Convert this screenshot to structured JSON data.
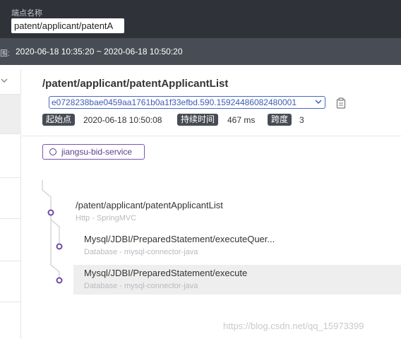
{
  "header": {
    "endpoint_label": "端点名称",
    "endpoint_value": "patent/applicant/patentA",
    "time_label": "围:",
    "time_range": "2020-06-18 10:35:20 ~ 2020-06-18 10:50:20"
  },
  "trace": {
    "title": "/patent/applicant/patentApplicantList",
    "trace_id": "e0728238bae0459aa1761b0a1f33efbd.590.15924486082480001",
    "start_label": "起始点",
    "start_value": "2020-06-18 10:50:08",
    "duration_label": "持续时间",
    "duration_value": "467 ms",
    "span_label": "跨度",
    "span_value": "3",
    "service": "jiangsu-bid-service"
  },
  "spans": [
    {
      "title": "/patent/applicant/patentApplicantList",
      "subtitle": "Http - SpringMVC"
    },
    {
      "title": "Mysql/JDBI/PreparedStatement/executeQuer...",
      "subtitle": "Database - mysql-connector-java"
    },
    {
      "title": "Mysql/JDBI/PreparedStatement/execute",
      "subtitle": "Database - mysql-connector-java"
    }
  ],
  "watermark": "https://blog.csdn.net/qq_15973399",
  "colors": {
    "accent": "#7b56b0",
    "dark": "#2f3339",
    "link": "#4a68c8"
  }
}
